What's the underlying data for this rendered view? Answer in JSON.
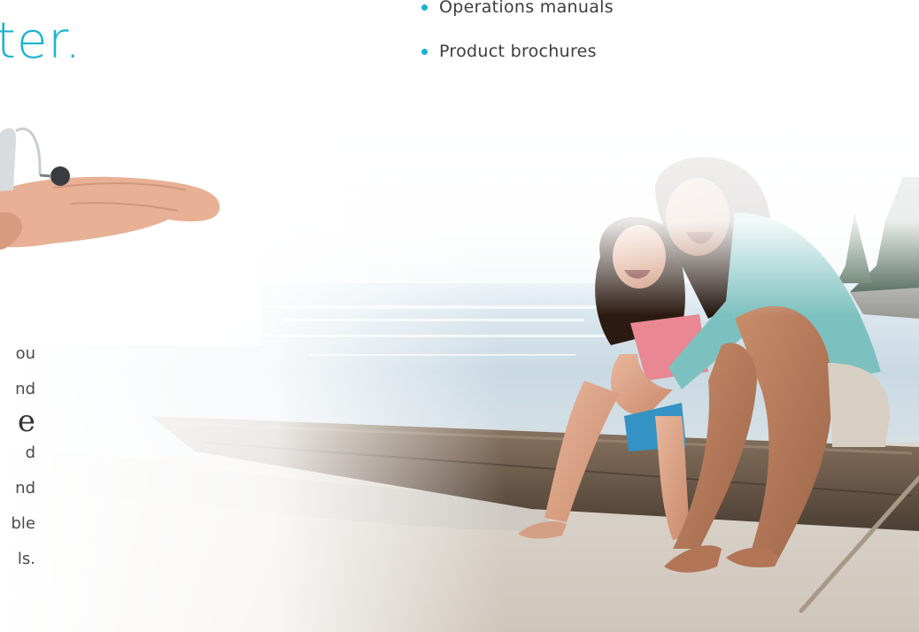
{
  "headline": {
    "text": "ter."
  },
  "bullets": [
    {
      "label": "Operations manuals"
    },
    {
      "label": "Product brochures"
    }
  ],
  "paragraph_fragments": [
    "ou",
    "nd",
    "e",
    "d",
    "nd",
    "ble",
    "ls."
  ],
  "colors": {
    "accent": "#19b3cf",
    "text": "#3d3d3d"
  },
  "icons": {
    "bullet": "dot-icon"
  }
}
